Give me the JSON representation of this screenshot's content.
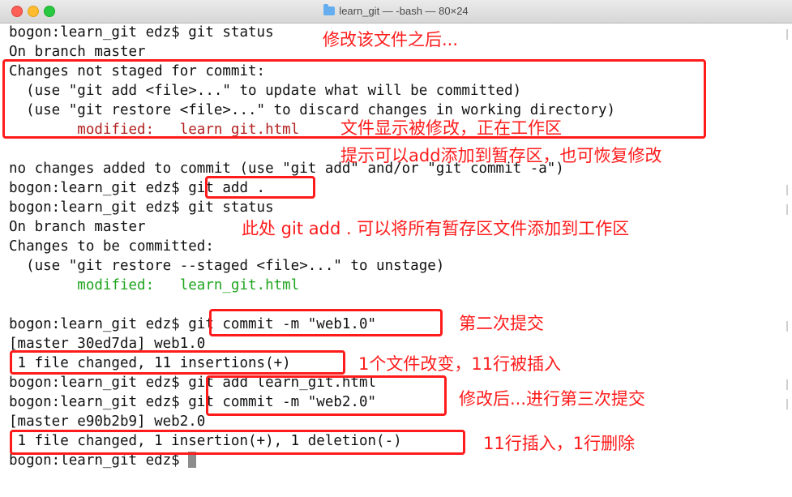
{
  "window": {
    "title": "learn_git — -bash — 80×24"
  },
  "terminal": {
    "l1": "bogon:learn_git edz$ git status",
    "l2": "On branch master",
    "l3": "Changes not staged for commit:",
    "l4": "  (use \"git add <file>...\" to update what will be committed)",
    "l5": "  (use \"git restore <file>...\" to discard changes in working directory)",
    "l6_label": "        modified:   ",
    "l6_file": "learn_git.html",
    "l8": "no changes added to commit (use \"git add\" and/or \"git commit -a\")",
    "l9": "bogon:learn_git edz$ git add .",
    "l10": "bogon:learn_git edz$ git status",
    "l11": "On branch master",
    "l12": "Changes to be committed:",
    "l13": "  (use \"git restore --staged <file>...\" to unstage)",
    "l14_label": "        modified:   ",
    "l14_file": "learn_git.html",
    "l16": "bogon:learn_git edz$ git commit -m \"web1.0\"",
    "l17": "[master 30ed7da] web1.0",
    "l18": " 1 file changed, 11 insertions(+)",
    "l19": "bogon:learn_git edz$ git add learn_git.html",
    "l20": "bogon:learn_git edz$ git commit -m \"web2.0\"",
    "l21": "[master e90b2b9] web2.0",
    "l22": " 1 file changed, 1 insertion(+), 1 deletion(-)",
    "l23": "bogon:learn_git edz$ "
  },
  "annotations": {
    "a1": "修改该文件之后...",
    "a2": "文件显示被修改，正在工作区",
    "a3": "提示可以add添加到暂存区，也可恢复修改",
    "a4": "此处 git add . 可以将所有暂存区文件添加到工作区",
    "a5": "第二次提交",
    "a6": "1个文件改变，11行被插入",
    "a7": "修改后...进行第三次提交",
    "a8": "11行插入，1行删除"
  },
  "colors": {
    "annotation": "#ff1b1b",
    "modified_unstaged": "#b22121",
    "modified_staged": "#1fa51f"
  }
}
